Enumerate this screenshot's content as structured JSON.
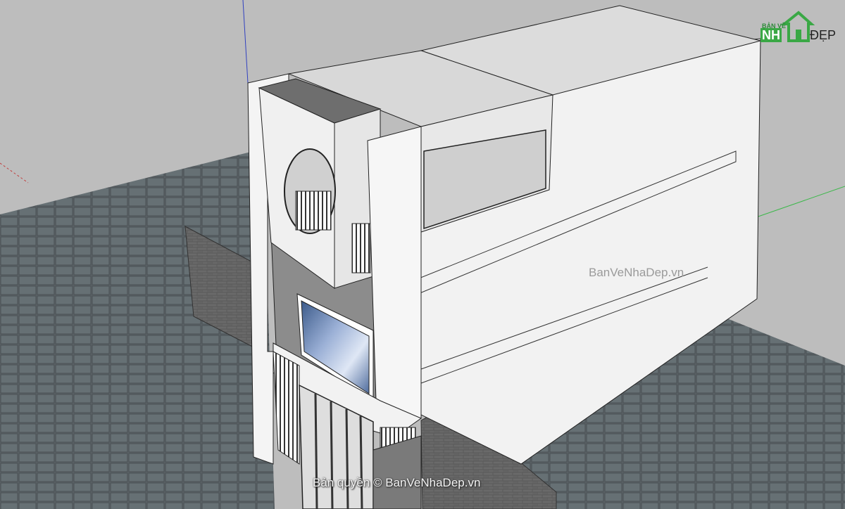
{
  "watermark": {
    "center": "BanVeNhaDep.vn",
    "bottom": "Bản quyền © BanVeNhaDep.vn"
  },
  "logo": {
    "top": "BẢN VẼ",
    "left": "NH",
    "right": "ĐẸP"
  },
  "colors": {
    "sky": "#bdbdbd",
    "pavement": "#5a6266",
    "wall_white": "#f2f2f2",
    "wall_shade": "#e0e0e0",
    "brick": "#585858",
    "accent_green": "#3aa845"
  }
}
